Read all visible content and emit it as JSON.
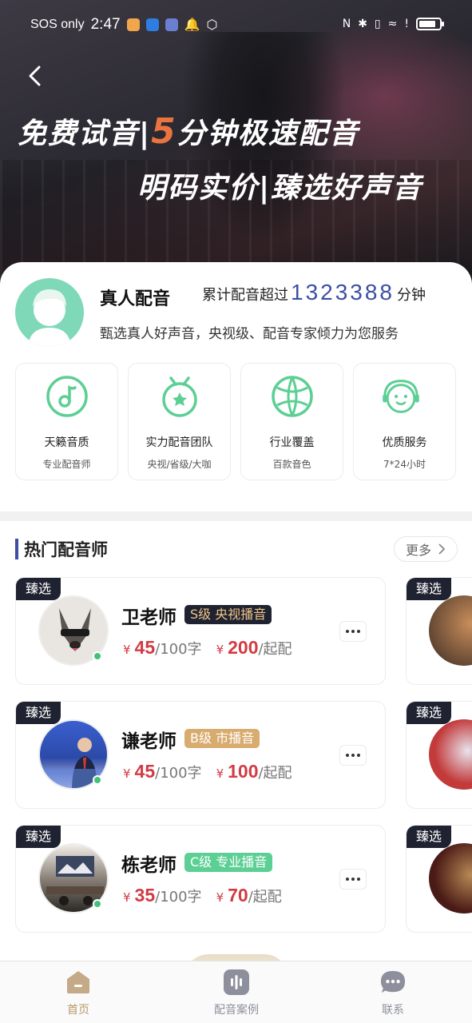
{
  "status_bar": {
    "carrier": "SOS only",
    "time": "2:47"
  },
  "hero": {
    "line1_a": "免费试音|",
    "line1_num": "5",
    "line1_b": "分钟极速配音",
    "line2": "明码实价|臻选好声音"
  },
  "intro": {
    "title": "真人配音",
    "count_label": "累计配音超过",
    "count_value": "1323388",
    "count_unit": "分钟",
    "subtitle": "甄选真人好声音，央视级、配音专家倾力为您服务"
  },
  "features": [
    {
      "title": "天籁音质",
      "sub": "专业配音师",
      "icon": "music-note-icon"
    },
    {
      "title": "实力配音团队",
      "sub": "央视/省级/大咖",
      "icon": "medal-icon"
    },
    {
      "title": "行业覆盖",
      "sub": "百款音色",
      "icon": "basketball-icon"
    },
    {
      "title": "优质服务",
      "sub": "7*24小时",
      "icon": "headset-smile-icon"
    }
  ],
  "hot": {
    "title": "热门配音师",
    "more": "更多",
    "pick_tag": "臻选",
    "voices": [
      {
        "name": "卫老师",
        "level": "S级 央视播音",
        "level_color": "#1f2230",
        "level_text_color": "#f0c58a",
        "rate_currency": "¥",
        "rate": "45",
        "rate_unit": "/100字",
        "min_currency": "¥",
        "min": "200",
        "min_unit": "/起配"
      },
      {
        "name": "谦老师",
        "level": "B级 市播音",
        "level_color": "#d8ab6e",
        "level_text_color": "#ffffff",
        "rate_currency": "¥",
        "rate": "45",
        "rate_unit": "/100字",
        "min_currency": "¥",
        "min": "100",
        "min_unit": "/起配"
      },
      {
        "name": "栋老师",
        "level": "C级 专业播音",
        "level_color": "#5ccf94",
        "level_text_color": "#ffffff",
        "rate_currency": "¥",
        "rate": "35",
        "rate_unit": "/100字",
        "min_currency": "¥",
        "min": "70",
        "min_unit": "/起配"
      }
    ]
  },
  "bottom_nav": [
    {
      "label": "首页",
      "active": true,
      "icon": "home-icon"
    },
    {
      "label": "配音案例",
      "active": false,
      "icon": "audio-wave-icon"
    },
    {
      "label": "联系",
      "active": false,
      "icon": "chat-icon"
    }
  ],
  "colors": {
    "accent": "#3c4fa3",
    "green": "#5ccf94",
    "price_red": "#d23b44",
    "gold": "#b8986a"
  }
}
